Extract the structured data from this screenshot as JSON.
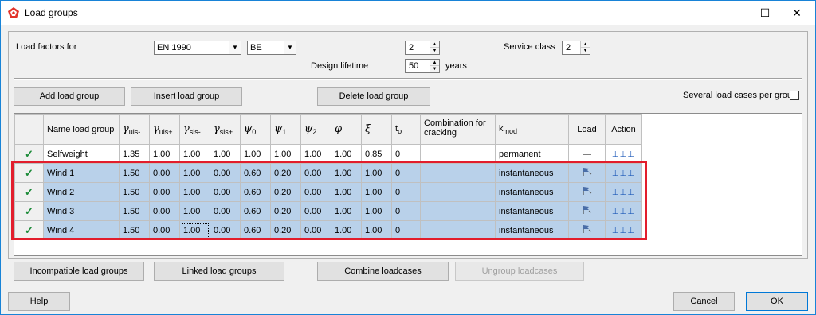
{
  "window": {
    "title": "Load groups",
    "min_glyph": "—",
    "max_glyph": "☐",
    "close_glyph": "✕",
    "app_icon": "app-logo-icon"
  },
  "top": {
    "load_factors_label": "Load factors for",
    "standard_value": "EN 1990",
    "country_value": "BE",
    "factor_spin_value": "2",
    "design_lifetime_label": "Design lifetime",
    "design_lifetime_value": "50",
    "years_label": "years",
    "service_class_label": "Service class",
    "service_class_value": "2"
  },
  "toolbar": {
    "add": "Add load group",
    "insert": "Insert load group",
    "delete": "Delete load group",
    "several_label": "Several load cases per group"
  },
  "table": {
    "headers": {
      "name": "Name load group",
      "combination_line1": "Combination for",
      "combination_line2": "cracking",
      "kmod": "k",
      "kmod_sub": "mod",
      "load": "Load",
      "action": "Action",
      "to": "t",
      "to_sub": "o"
    },
    "greek": {
      "gamma": "γ",
      "psi": "ψ",
      "phi": "φ",
      "xi": "ξ",
      "uls_minus": "uls-",
      "uls_plus": "uls+",
      "sls_minus": "sls-",
      "sls_plus": "sls+",
      "s0": "0",
      "s1": "1",
      "s2": "2"
    },
    "check_glyph": "✓",
    "rows": [
      {
        "name": "Selfweight",
        "g_uls_m": "1.35",
        "g_uls_p": "1.00",
        "g_sls_m": "1.00",
        "g_sls_p": "1.00",
        "psi0": "1.00",
        "psi1": "1.00",
        "psi2": "1.00",
        "phi": "1.00",
        "xi": "0.85",
        "to": "0",
        "comb": "",
        "kmod": "permanent",
        "load": "—",
        "action": "⊥⊥⊥"
      },
      {
        "name": "Wind 1",
        "g_uls_m": "1.50",
        "g_uls_p": "0.00",
        "g_sls_m": "1.00",
        "g_sls_p": "0.00",
        "psi0": "0.60",
        "psi1": "0.20",
        "psi2": "0.00",
        "phi": "1.00",
        "xi": "1.00",
        "to": "0",
        "comb": "",
        "kmod": "instantaneous",
        "load": "flag-icon",
        "action": "⊥⊥⊥"
      },
      {
        "name": "Wind 2",
        "g_uls_m": "1.50",
        "g_uls_p": "0.00",
        "g_sls_m": "1.00",
        "g_sls_p": "0.00",
        "psi0": "0.60",
        "psi1": "0.20",
        "psi2": "0.00",
        "phi": "1.00",
        "xi": "1.00",
        "to": "0",
        "comb": "",
        "kmod": "instantaneous",
        "load": "flag-icon",
        "action": "⊥⊥⊥"
      },
      {
        "name": "Wind 3",
        "g_uls_m": "1.50",
        "g_uls_p": "0.00",
        "g_sls_m": "1.00",
        "g_sls_p": "0.00",
        "psi0": "0.60",
        "psi1": "0.20",
        "psi2": "0.00",
        "phi": "1.00",
        "xi": "1.00",
        "to": "0",
        "comb": "",
        "kmod": "instantaneous",
        "load": "flag-icon",
        "action": "⊥⊥⊥"
      },
      {
        "name": "Wind 4",
        "g_uls_m": "1.50",
        "g_uls_p": "0.00",
        "g_sls_m": "1.00",
        "g_sls_p": "0.00",
        "psi0": "0.60",
        "psi1": "0.20",
        "psi2": "0.00",
        "phi": "1.00",
        "xi": "1.00",
        "to": "0",
        "comb": "",
        "kmod": "instantaneous",
        "load": "flag-icon",
        "action": "⊥⊥⊥"
      }
    ]
  },
  "bottom_buttons": {
    "incompatible": "Incompatible load groups",
    "linked": "Linked load groups",
    "combine": "Combine loadcases",
    "ungroup": "Ungroup loadcases"
  },
  "footer": {
    "help": "Help",
    "cancel": "Cancel",
    "ok": "OK"
  },
  "colors": {
    "selection": "#b9d1ea",
    "highlight_border": "#e21d2c",
    "check": "#1e8c3a",
    "title_border": "#1883d7"
  }
}
